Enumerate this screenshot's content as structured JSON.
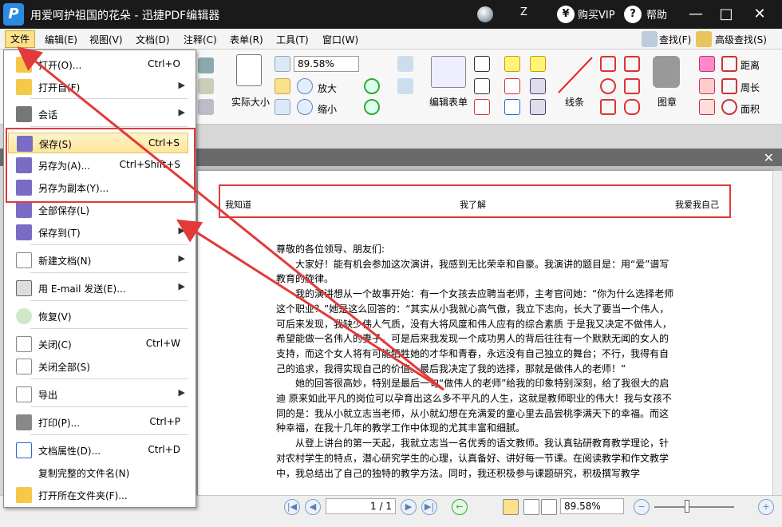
{
  "titlebar": {
    "title": "用爱呵护祖国的花朵 - 迅捷PDF编辑器",
    "user_initial": "Z",
    "vip_label": "购买VIP",
    "help_label": "帮助",
    "minimize": "—",
    "maximize": "□",
    "close": "✕"
  },
  "menubar": {
    "items": [
      "文件",
      "编辑(E)",
      "视图(V)",
      "文档(D)",
      "注释(C)",
      "表单(R)",
      "工具(T)",
      "窗口(W)"
    ],
    "find_label": "查找(F)",
    "adv_find_label": "高级查找(S)"
  },
  "ribbon": {
    "zoom_value": "89.58%",
    "actual_size": "实际大小",
    "zoom_in": "放大",
    "zoom_out": "缩小",
    "edit_form": "编辑表单",
    "line": "线条",
    "stamp": "图章",
    "distance": "距离",
    "perimeter": "周长",
    "area": "面积"
  },
  "file_menu": {
    "items": [
      {
        "label": "打开(O)...",
        "shortcut": "Ctrl+O"
      },
      {
        "label": "打开自(F)",
        "shortcut": ""
      },
      {
        "label": "会话",
        "shortcut": ""
      },
      {
        "label": "保存(S)",
        "shortcut": "Ctrl+S"
      },
      {
        "label": "另存为(A)...",
        "shortcut": "Ctrl+Shift+S"
      },
      {
        "label": "另存为副本(Y)...",
        "shortcut": ""
      },
      {
        "label": "全部保存(L)",
        "shortcut": ""
      },
      {
        "label": "保存到(T)",
        "shortcut": ""
      },
      {
        "label": "新建文档(N)",
        "shortcut": ""
      },
      {
        "label": "用 E-mail 发送(E)...",
        "shortcut": ""
      },
      {
        "label": "恢复(V)",
        "shortcut": ""
      },
      {
        "label": "关闭(C)",
        "shortcut": "Ctrl+W"
      },
      {
        "label": "关闭全部(S)",
        "shortcut": ""
      },
      {
        "label": "导出",
        "shortcut": ""
      },
      {
        "label": "打印(P)...",
        "shortcut": "Ctrl+P"
      },
      {
        "label": "文档属性(D)...",
        "shortcut": "Ctrl+D"
      },
      {
        "label": "复制完整的文件名(N)",
        "shortcut": ""
      },
      {
        "label": "打开所在文件夹(F)...",
        "shortcut": ""
      }
    ]
  },
  "document": {
    "header_left": "我知道",
    "header_center": "我了解",
    "header_right": "我爱我自己",
    "paragraphs": [
      "尊敬的各位领导、朋友们:",
      "　　大家好！能有机会参加这次演讲，我感到无比荣幸和自豪。我演讲的题目是：用“爱”谱写教育的旋律。",
      "　　我的演讲想从一个故事开始：有一个女孩去应聘当老师，主考官问她：“你为什么选择老师这个职业？”她是这么回答的：“其实从小我就心高气傲，我立下志向，长大了要当一个伟人，可后来发现，我缺少伟人气质，没有大将风度和伟人应有的综合素质 于是我又决定不做伟人，希望能做一名伟人的妻子，可是后来我发现一个成功男人的背后往往有一个默默无闻的女人的支持，而这个女人将有可能牺牲她的才华和青春，永远没有自己独立的舞台；不行，我得有自己的追求，我得实现自己的价值。最后我决定了我的选择，那就是做伟人的老师！”",
      "　　她的回答很高妙，特别是最后一句“做伟人的老师”给我的印象特别深刻，给了我很大的启迪 原来如此平凡的岗位可以孕育出这么多不平凡的人生，这就是教师职业的伟大！我与女孩不同的是：我从小就立志当老师，从小就幻想在充满爱的童心里去品尝桃李满天下的幸福。而这种幸福，在我十几年的教学工作中体现的尤其丰富和细腻。",
      "　　从登上讲台的第一天起，我就立志当一名优秀的语文教师。我认真钻研教育教学理论，针对农村学生的特点，潜心研究学生的心理，认真备好、讲好每一节课。在阅读教学和作文教学中，我总结出了自己的独特的教学方法。同时，我还积极参与课题研究，积极撰写教学"
    ]
  },
  "statusbar": {
    "page_value": "1 / 1",
    "zoom_value": "89.58%"
  },
  "colors": {
    "annotation_red": "#e23a3a",
    "highlight": "#fde59a"
  }
}
